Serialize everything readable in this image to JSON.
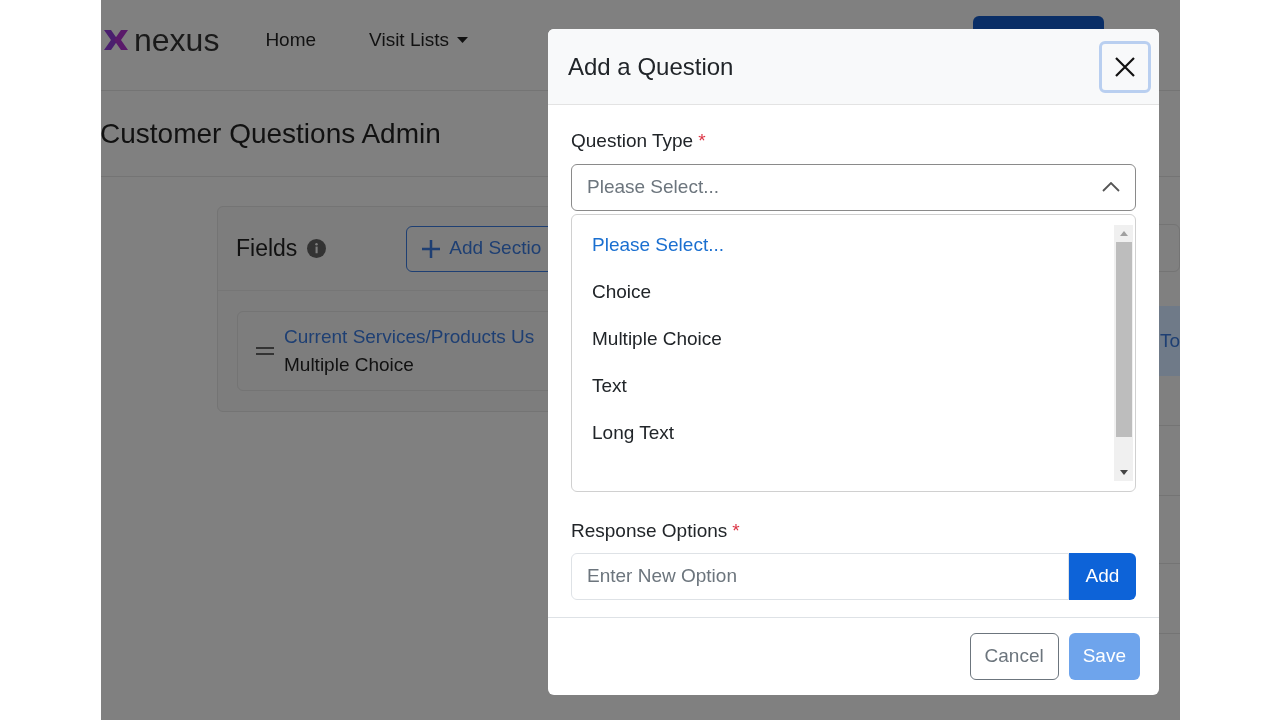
{
  "nav": {
    "logo": "nexus",
    "items": [
      {
        "label": "Home",
        "dropdown": false
      },
      {
        "label": "Visit Lists",
        "dropdown": true
      }
    ]
  },
  "page_title": "Customer Questions Admin",
  "fields_card": {
    "title": "Fields",
    "add_section_button": "Add Sectio",
    "fields": [
      {
        "name": "Current Services/Products Us",
        "type": "Multiple Choice"
      }
    ]
  },
  "side_table": {
    "rows": [
      {
        "text": "To"
      }
    ]
  },
  "modal": {
    "title": "Add a Question",
    "question_type": {
      "label": "Question Type",
      "required_mark": "*",
      "value": "Please Select...",
      "expanded": true,
      "options": [
        {
          "label": "Please Select...",
          "selected": true
        },
        {
          "label": "Choice",
          "selected": false
        },
        {
          "label": "Multiple Choice",
          "selected": false
        },
        {
          "label": "Text",
          "selected": false
        },
        {
          "label": "Long Text",
          "selected": false
        }
      ]
    },
    "response_options": {
      "label": "Response Options",
      "required_mark": "*",
      "placeholder": "Enter New Option",
      "add_button": "Add"
    },
    "buttons": [
      {
        "label": "Cancel",
        "kind": "secondary",
        "disabled": false
      },
      {
        "label": "Save",
        "kind": "primary",
        "disabled": true
      }
    ]
  }
}
